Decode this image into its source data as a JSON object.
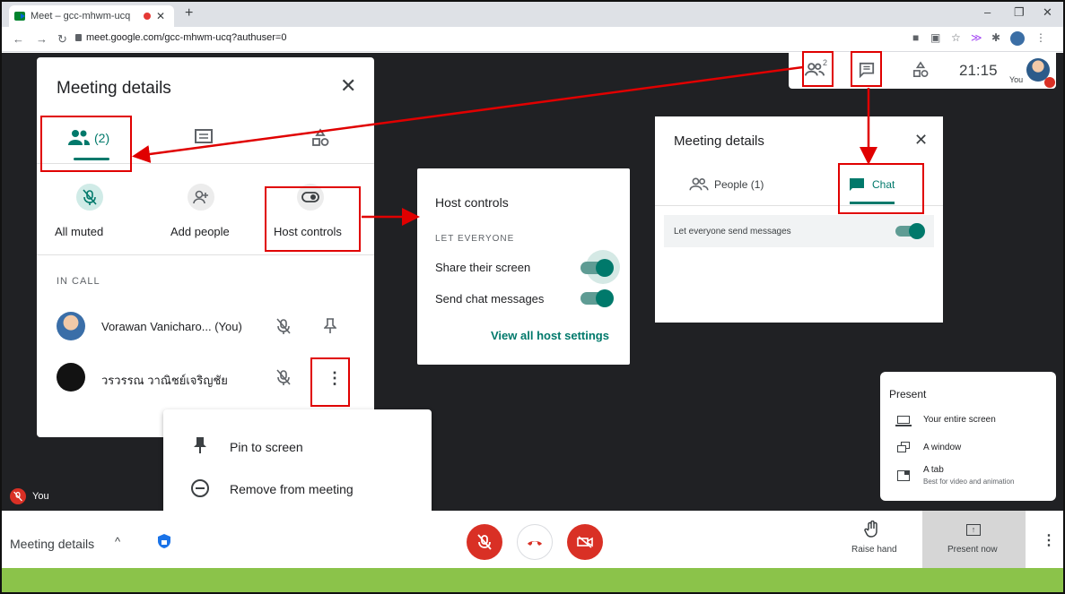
{
  "browser": {
    "tab_title": "Meet – gcc-mhwm-ucq",
    "url": "meet.google.com/gcc-mhwm-ucq?authuser=0"
  },
  "top_right": {
    "people_badge": "2",
    "time": "21:15",
    "you_label": "You"
  },
  "details_panel": {
    "title": "Meeting details",
    "people_tab": "(2)",
    "actions": {
      "all_muted": "All muted",
      "add_people": "Add people",
      "host_controls": "Host controls"
    },
    "in_call": "IN CALL",
    "participants": [
      {
        "name": "Vorawan Vanicharo... (You)"
      },
      {
        "name": "วรวรรณ วาณิชย์เจริญชัย"
      }
    ]
  },
  "context_menu": {
    "pin": "Pin to screen",
    "remove": "Remove from meeting"
  },
  "host_controls": {
    "title": "Host controls",
    "section": "LET EVERYONE",
    "share": "Share their screen",
    "chat": "Send chat messages",
    "link": "View all host settings"
  },
  "details_panel_2": {
    "title": "Meeting details",
    "people_tab": "People (1)",
    "chat_tab": "Chat",
    "let_everyone": "Let everyone send messages"
  },
  "present_menu": {
    "title": "Present",
    "entire": "Your entire screen",
    "window": "A window",
    "tab": "A tab",
    "tab_sub": "Best for video and animation"
  },
  "self_label": "You",
  "bottom": {
    "meeting_details": "Meeting details",
    "raise_hand": "Raise hand",
    "present_now": "Present now"
  },
  "colors": {
    "accent": "#00796b",
    "danger": "#d93025",
    "annotation": "#e00000"
  }
}
